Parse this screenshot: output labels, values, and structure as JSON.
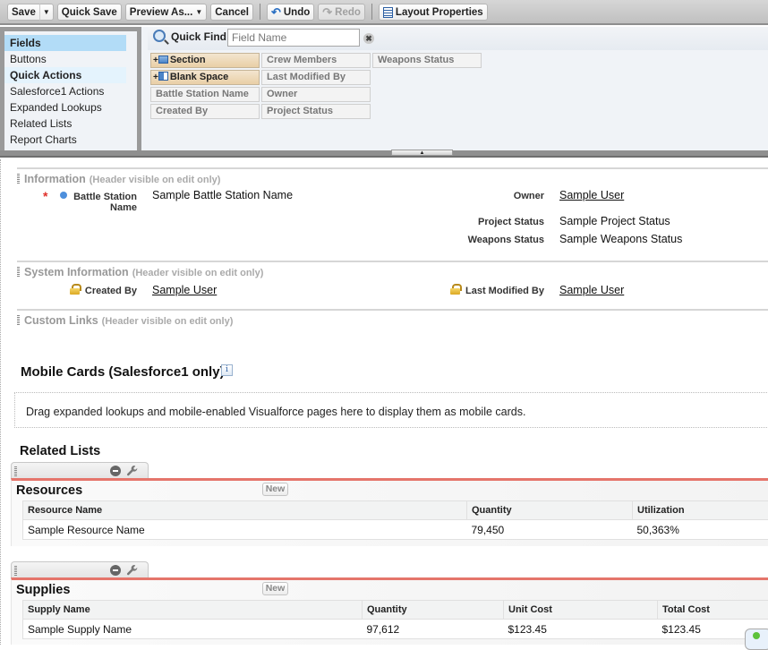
{
  "toolbar": {
    "save_label": "Save",
    "quick_save_label": "Quick Save",
    "preview_as_label": "Preview As...",
    "cancel_label": "Cancel",
    "undo_label": "Undo",
    "redo_label": "Redo",
    "layout_properties_label": "Layout Properties",
    "icons": {
      "undo": "undo-arrow-icon",
      "redo": "redo-arrow-icon",
      "layout": "layout-properties-icon",
      "dropdown": "caret-down-icon"
    }
  },
  "palette": {
    "categories": [
      {
        "label": "Fields",
        "state": "selected"
      },
      {
        "label": "Buttons",
        "state": "normal"
      },
      {
        "label": "Quick Actions",
        "state": "highlighted"
      },
      {
        "label": "Salesforce1 Actions",
        "state": "normal"
      },
      {
        "label": "Expanded Lookups",
        "state": "normal"
      },
      {
        "label": "Related Lists",
        "state": "normal"
      },
      {
        "label": "Report Charts",
        "state": "normal"
      }
    ],
    "quick_find": {
      "label": "Quick Find",
      "placeholder": "Field Name",
      "value": "",
      "clear_glyph": "✖"
    },
    "fields": [
      {
        "label": "Section",
        "type": "special"
      },
      {
        "label": "Blank Space",
        "type": "special"
      },
      {
        "label": "Battle Station Name",
        "type": "field"
      },
      {
        "label": "Created By",
        "type": "field"
      },
      {
        "label": "Crew Members",
        "type": "field"
      },
      {
        "label": "Last Modified By",
        "type": "field"
      },
      {
        "label": "Owner",
        "type": "field"
      },
      {
        "label": "Project Status",
        "type": "field"
      },
      {
        "label": "Weapons Status",
        "type": "field"
      }
    ],
    "collapse_glyph": "▲"
  },
  "sections": {
    "information": {
      "title": "Information",
      "note": "(Header visible on edit only)",
      "fields": {
        "battle_station_name": {
          "label": "Battle Station Name",
          "value": "Sample Battle Station Name",
          "required": true
        },
        "owner": {
          "label": "Owner",
          "value": "Sample User"
        },
        "project_status": {
          "label": "Project Status",
          "value": "Sample Project Status"
        },
        "weapons_status": {
          "label": "Weapons Status",
          "value": "Sample Weapons Status"
        }
      },
      "required_glyph": "*"
    },
    "system_information": {
      "title": "System Information",
      "note": "(Header visible on edit only)",
      "fields": {
        "created_by": {
          "label": "Created By",
          "value": "Sample User"
        },
        "last_modified_by": {
          "label": "Last Modified By",
          "value": "Sample User"
        }
      }
    },
    "custom_links": {
      "title": "Custom Links",
      "note": "(Header visible on edit only)"
    }
  },
  "mobile_cards": {
    "title": "Mobile Cards (Salesforce1 only)",
    "info_glyph": "i",
    "drop_text": "Drag expanded lookups and mobile-enabled Visualforce pages here to display them as mobile cards."
  },
  "related_lists": {
    "title": "Related Lists",
    "lists": [
      {
        "title": "Resources",
        "new_label": "New",
        "columns": [
          "Resource Name",
          "Quantity",
          "Utilization"
        ],
        "rows": [
          [
            "Sample Resource Name",
            "79,450",
            "50,363%"
          ]
        ]
      },
      {
        "title": "Supplies",
        "new_label": "New",
        "columns": [
          "Supply Name",
          "Quantity",
          "Unit Cost",
          "Total Cost"
        ],
        "rows": [
          [
            "Sample Supply Name",
            "97,612",
            "$123.45",
            "$123.45"
          ]
        ]
      }
    ]
  },
  "colors": {
    "accent_red": "#e5756b",
    "selected_category": "#b2dcf7",
    "required": "#e0302a"
  }
}
